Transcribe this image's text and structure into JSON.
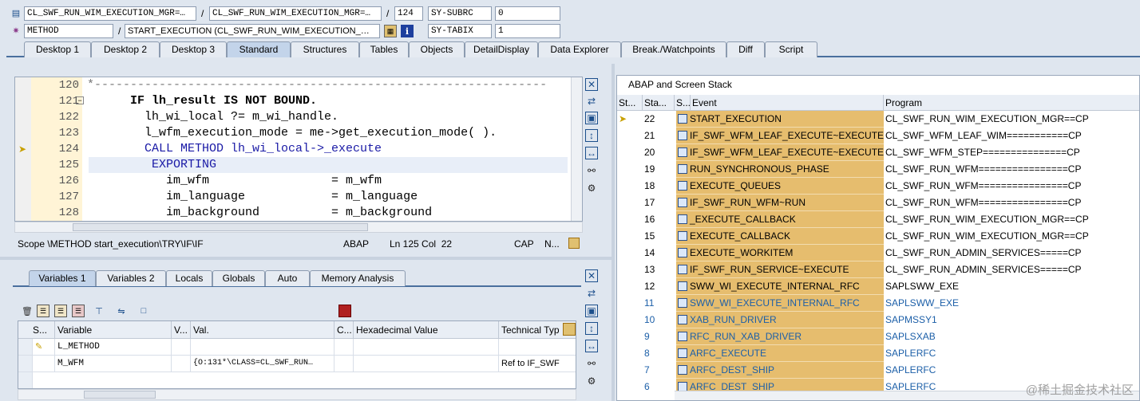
{
  "header": {
    "row1": {
      "program": "CL_SWF_RUN_WIM_EXECUTION_MGR=…",
      "include": "CL_SWF_RUN_WIM_EXECUTION_MGR=…",
      "line": "124",
      "var_name": "SY-SUBRC",
      "var_value": "0"
    },
    "row2": {
      "type": "METHOD",
      "event": "START_EXECUTION (CL_SWF_RUN_WIM_EXECUTION_…",
      "var_name": "SY-TABIX",
      "var_value": "1"
    }
  },
  "tabs": [
    "Desktop 1",
    "Desktop 2",
    "Desktop 3",
    "Standard",
    "Structures",
    "Tables",
    "Objects",
    "DetailDisplay",
    "Data Explorer",
    "Break./Watchpoints",
    "Diff",
    "Script"
  ],
  "code": {
    "line_numbers": [
      "120",
      "121",
      "122",
      "123",
      "124",
      "125",
      "126",
      "127",
      "128"
    ],
    "lines": [
      "*---------------------------------------------------------------",
      "      IF lh_result IS NOT BOUND.",
      "        lh_wi_local ?= m_wi_handle.",
      "        l_wfm_execution_mode = me->get_execution_mode( ).",
      "        CALL METHOD lh_wi_local->_execute",
      "         EXPORTING",
      "           im_wfm                 = m_wfm",
      "           im_language            = m_language",
      "           im_background          = m_background"
    ]
  },
  "status": {
    "scope": "Scope \\METHOD start_execution\\TRY\\IF\\IF",
    "lang": "ABAP",
    "position": "Ln 125 Col  22",
    "caps": "CAP",
    "num": "N..."
  },
  "var_tabs": [
    "Variables 1",
    "Variables 2",
    "Locals",
    "Globals",
    "Auto",
    "Memory Analysis"
  ],
  "var_grid": {
    "headers": [
      "S...",
      "Variable",
      "V...",
      "Val.",
      "C...",
      "Hexadecimal Value",
      "Technical Typ"
    ],
    "rows": [
      {
        "variable": "L_METHOD",
        "value": "",
        "tech": ""
      },
      {
        "variable": "M_WFM",
        "value": "{O:131*\\CLASS=CL_SWF_RUN…",
        "tech": "Ref to IF_SWF"
      }
    ]
  },
  "stack": {
    "title": "ABAP and Screen Stack",
    "headers": [
      "St...",
      "Sta...",
      "S...",
      "Event",
      "Program"
    ],
    "rows": [
      {
        "num": "22",
        "event": "START_EXECUTION",
        "program": "CL_SWF_RUN_WIM_EXECUTION_MGR==CP",
        "current": true,
        "blue": false
      },
      {
        "num": "21",
        "event": "IF_SWF_WFM_LEAF_EXECUTE~EXECUTE",
        "program": "CL_SWF_WFM_LEAF_WIM===========CP",
        "current": false,
        "blue": false
      },
      {
        "num": "20",
        "event": "IF_SWF_WFM_LEAF_EXECUTE~EXECUTE",
        "program": "CL_SWF_WFM_STEP===============CP",
        "current": false,
        "blue": false
      },
      {
        "num": "19",
        "event": "RUN_SYNCHRONOUS_PHASE",
        "program": "CL_SWF_RUN_WFM================CP",
        "current": false,
        "blue": false
      },
      {
        "num": "18",
        "event": "EXECUTE_QUEUES",
        "program": "CL_SWF_RUN_WFM================CP",
        "current": false,
        "blue": false
      },
      {
        "num": "17",
        "event": "IF_SWF_RUN_WFM~RUN",
        "program": "CL_SWF_RUN_WFM================CP",
        "current": false,
        "blue": false
      },
      {
        "num": "16",
        "event": "_EXECUTE_CALLBACK",
        "program": "CL_SWF_RUN_WIM_EXECUTION_MGR==CP",
        "current": false,
        "blue": false
      },
      {
        "num": "15",
        "event": "EXECUTE_CALLBACK",
        "program": "CL_SWF_RUN_WIM_EXECUTION_MGR==CP",
        "current": false,
        "blue": false
      },
      {
        "num": "14",
        "event": "EXECUTE_WORKITEM",
        "program": "CL_SWF_RUN_ADMIN_SERVICES=====CP",
        "current": false,
        "blue": false
      },
      {
        "num": "13",
        "event": "IF_SWF_RUN_SERVICE~EXECUTE",
        "program": "CL_SWF_RUN_ADMIN_SERVICES=====CP",
        "current": false,
        "blue": false
      },
      {
        "num": "12",
        "event": "SWW_WI_EXECUTE_INTERNAL_RFC",
        "program": "SAPLSWW_EXE",
        "current": false,
        "blue": false
      },
      {
        "num": "11",
        "event": "SWW_WI_EXECUTE_INTERNAL_RFC",
        "program": "SAPLSWW_EXE",
        "current": false,
        "blue": true
      },
      {
        "num": "10",
        "event": "XAB_RUN_DRIVER",
        "program": "SAPMSSY1",
        "current": false,
        "blue": true
      },
      {
        "num": "9",
        "event": "RFC_RUN_XAB_DRIVER",
        "program": "SAPLSXAB",
        "current": false,
        "blue": true
      },
      {
        "num": "8",
        "event": "ARFC_EXECUTE",
        "program": "SAPLERFC",
        "current": false,
        "blue": true
      },
      {
        "num": "7",
        "event": "ARFC_DEST_SHIP",
        "program": "SAPLERFC",
        "current": false,
        "blue": true
      },
      {
        "num": "6",
        "event": "ARFC_DEST_SHIP",
        "program": "SAPLERFC",
        "current": false,
        "blue": true
      }
    ]
  },
  "watermark": "@稀土掘金技术社区",
  "colors": {
    "event_bg": "#e6bd6e",
    "tab_active": "#c3d4ea",
    "link_blue": "#1c5fa8"
  }
}
